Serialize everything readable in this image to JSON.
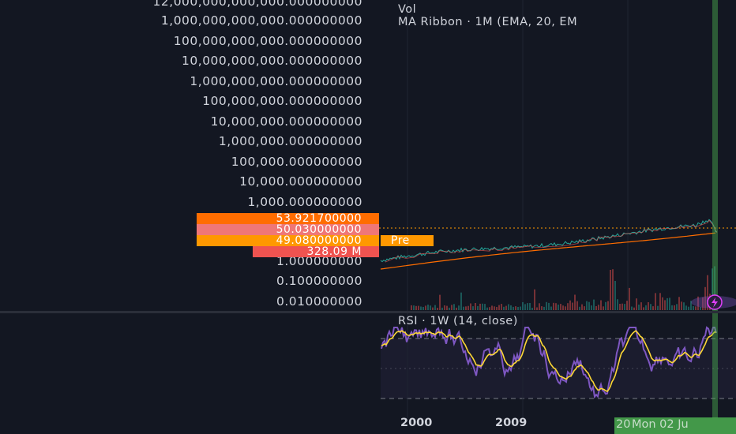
{
  "price_axis": {
    "labels": [
      "12,000,000,000,000.000000000",
      "1,000,000,000,000.000000000",
      "100,000,000,000.000000000",
      "10,000,000,000.000000000",
      "1,000,000,000.000000000",
      "100,000,000.000000000",
      "10,000,000.000000000",
      "1,000,000.000000000",
      "100,000.000000000",
      "10,000.000000000",
      "1,000.000000000",
      "1.000000000",
      "0.100000000",
      "0.010000000"
    ]
  },
  "badges": {
    "price_high": "53.921700000",
    "price_mid": "50.030000000",
    "price_pre": "49.080000000",
    "pre_label": "Pre",
    "volume": "328.09 M"
  },
  "legend": {
    "vol": "Vol",
    "ma_ribbon": "MA Ribbon · 1M (EMA, 20, EM"
  },
  "rsi": {
    "title": "RSI · 1W (14, close)"
  },
  "x_axis": {
    "labels": [
      "2000",
      "2009"
    ],
    "crosshair_label": "Mon 02 Ju",
    "crosshair_prefix": "20"
  },
  "colors": {
    "background": "#131722",
    "price_line": "#26a69a",
    "ema_line": "#ff6d00",
    "rsi_line": "#7e57c2",
    "rsi_ma": "#fdd835",
    "crosshair": "#4caf50",
    "badge_orange": "#ff6d00",
    "badge_pink": "#ef7777",
    "badge_red": "#ef5350"
  },
  "icons": {
    "indicator_icon": "lightning-icon"
  }
}
